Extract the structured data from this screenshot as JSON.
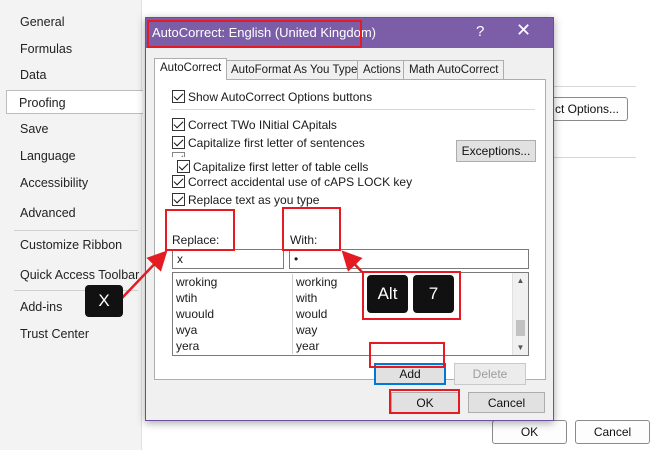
{
  "sidebar": {
    "items": [
      {
        "label": "General"
      },
      {
        "label": "Formulas"
      },
      {
        "label": "Data"
      },
      {
        "label": "Proofing"
      },
      {
        "label": "Save"
      },
      {
        "label": "Language"
      },
      {
        "label": "Accessibility"
      },
      {
        "label": "Advanced"
      },
      {
        "label": "Customize Ribbon"
      },
      {
        "label": "Quick Access Toolbar"
      },
      {
        "label": "Add-ins"
      },
      {
        "label": "Trust Center"
      }
    ],
    "selected": "Proofing"
  },
  "background_window": {
    "autocorrect_options_button": "ct Options...",
    "ok": "OK",
    "cancel": "Cancel"
  },
  "dialog": {
    "title": "AutoCorrect: English (United Kingdom)",
    "help": "?",
    "close": "✕",
    "tabs": [
      "AutoCorrect",
      "AutoFormat As You Type",
      "Actions",
      "Math AutoCorrect"
    ],
    "active_tab": "AutoCorrect",
    "show_options": "Show AutoCorrect Options buttons",
    "checkboxes": [
      "Correct TWo INitial CApitals",
      "Capitalize first letter of sentences",
      "Capitalize first letter of table cells",
      "Correct accidental use of cAPS LOCK key",
      "Replace text as you type"
    ],
    "exceptions_button": "Exceptions...",
    "replace_label": "Replace:",
    "with_label": "With:",
    "replace_value": "x",
    "with_value": "•",
    "list": [
      {
        "replace": "wroking",
        "with": "working"
      },
      {
        "replace": "wtih",
        "with": "with"
      },
      {
        "replace": "wuould",
        "with": "would"
      },
      {
        "replace": "wya",
        "with": "way"
      },
      {
        "replace": "yera",
        "with": "year"
      }
    ],
    "add_button": "Add",
    "delete_button": "Delete",
    "ok_button": "OK",
    "cancel_button": "Cancel"
  },
  "annotations": {
    "key_x": "X",
    "key_alt": "Alt",
    "key_7": "7"
  },
  "colors": {
    "title_bar": "#7b5ea7",
    "highlight": "#e41b23",
    "default_button_border": "#0078d7"
  }
}
